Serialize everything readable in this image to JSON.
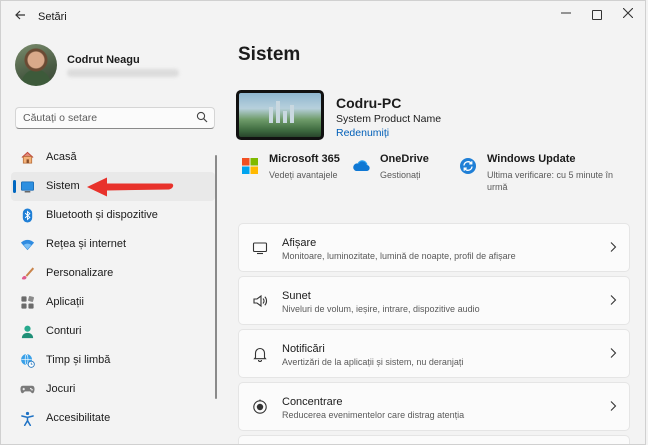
{
  "window": {
    "title": "Setări"
  },
  "colors": {
    "accent": "#0067c0",
    "link": "#005fb8",
    "arrow": "#e8322b"
  },
  "user": {
    "name": "Codrut Neagu"
  },
  "search": {
    "placeholder": "Căutați o setare"
  },
  "nav": {
    "items": [
      {
        "label": "Acasă",
        "icon": "home-icon"
      },
      {
        "label": "Sistem",
        "icon": "system-icon",
        "selected": true
      },
      {
        "label": "Bluetooth și dispozitive",
        "icon": "bluetooth-icon"
      },
      {
        "label": "Rețea și internet",
        "icon": "wifi-icon"
      },
      {
        "label": "Personalizare",
        "icon": "brush-icon"
      },
      {
        "label": "Aplicații",
        "icon": "apps-icon"
      },
      {
        "label": "Conturi",
        "icon": "account-icon"
      },
      {
        "label": "Timp și limbă",
        "icon": "globe-clock-icon"
      },
      {
        "label": "Jocuri",
        "icon": "gamepad-icon"
      },
      {
        "label": "Accesibilitate",
        "icon": "accessibility-icon"
      }
    ]
  },
  "main": {
    "title": "Sistem",
    "device": {
      "name": "Codru-PC",
      "model": "System Product Name",
      "rename": "Redenumiți"
    },
    "quick": [
      {
        "title": "Microsoft 365",
        "subtitle": "Vedeți avantajele",
        "icon": "microsoft-icon"
      },
      {
        "title": "OneDrive",
        "subtitle": "Gestionați",
        "icon": "onedrive-icon"
      },
      {
        "title": "Windows Update",
        "subtitle": "Ultima verificare: cu 5 minute în urmă",
        "icon": "windows-update-icon"
      }
    ],
    "cards": [
      {
        "title": "Afișare",
        "subtitle": "Monitoare, luminozitate, lumină de noapte, profil de afișare",
        "icon": "display-icon"
      },
      {
        "title": "Sunet",
        "subtitle": "Niveluri de volum, ieșire, intrare, dispozitive audio",
        "icon": "speaker-icon"
      },
      {
        "title": "Notificări",
        "subtitle": "Avertizări de la aplicații și sistem, nu deranjați",
        "icon": "bell-icon"
      },
      {
        "title": "Concentrare",
        "subtitle": "Reducerea evenimentelor care distrag atenția",
        "icon": "focus-icon"
      }
    ]
  }
}
